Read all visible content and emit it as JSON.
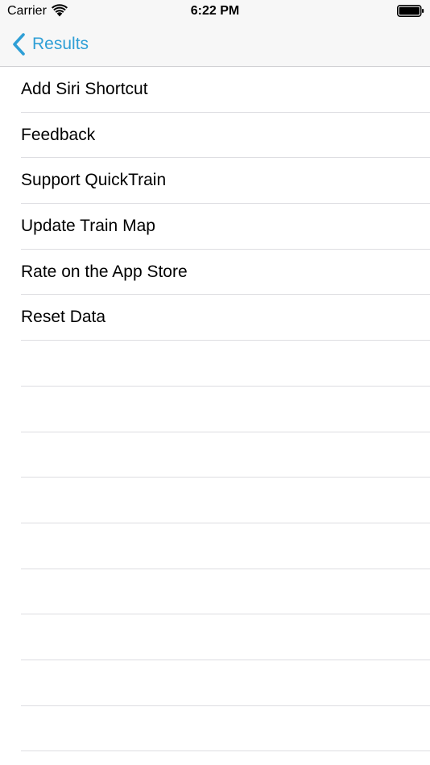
{
  "status_bar": {
    "carrier": "Carrier",
    "time": "6:22 PM",
    "wifi_icon": "wifi-icon",
    "battery_icon": "battery-icon"
  },
  "nav_bar": {
    "back_label": "Results",
    "back_icon": "chevron-left-icon",
    "accent_color": "#2f9fd6"
  },
  "menu": {
    "items": [
      {
        "label": "Add Siri Shortcut"
      },
      {
        "label": "Feedback"
      },
      {
        "label": "Support QuickTrain"
      },
      {
        "label": "Update Train Map"
      },
      {
        "label": "Rate on the App Store"
      },
      {
        "label": "Reset Data"
      }
    ]
  }
}
